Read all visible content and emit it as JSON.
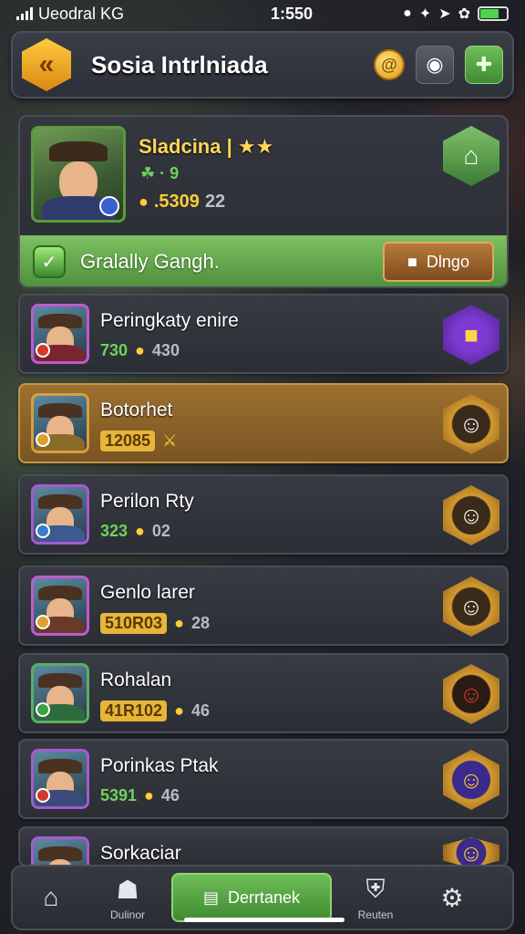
{
  "status_bar": {
    "carrier": "Ueodral KG",
    "time": "1:550"
  },
  "header": {
    "back_icon": "chevron-left-icon",
    "title": "Sosia Intrlniada",
    "coin_icon": "coin-icon",
    "map_icon": "map-pin-icon",
    "add_icon": "plus-icon"
  },
  "profile": {
    "name": "Sladcina |",
    "sub": "☘ · 9",
    "gold": ".5309",
    "extra": "22",
    "guild_label": "Gralally Gangh.",
    "guild_button": "Dlngo"
  },
  "rows": [
    {
      "name": "Peringkaty enire",
      "stat_a": "730",
      "stat_a_style": "green",
      "stat_b": "430",
      "badge": "purple"
    },
    {
      "name": "Botorhet",
      "stat_a": "12085",
      "stat_a_style": "pill",
      "stat_b": "",
      "badge": "gold"
    },
    {
      "name": "Perilon Rty",
      "stat_a": "323",
      "stat_a_style": "green",
      "stat_b": "02",
      "badge": "gold"
    },
    {
      "name": "Genlo larer",
      "stat_a": "510R03",
      "stat_a_style": "pill",
      "stat_b": "28",
      "badge": "gold"
    },
    {
      "name": "Rohalan",
      "stat_a": "41R102",
      "stat_a_style": "pill",
      "stat_b": "46",
      "badge": "gold-r"
    },
    {
      "name": "Porinkas Ptak",
      "stat_a": "5391",
      "stat_a_style": "green",
      "stat_b": "46",
      "badge": "navy"
    },
    {
      "name": "Sorkaciar",
      "stat_a": "",
      "stat_a_style": "",
      "stat_b": "",
      "badge": "navy"
    }
  ],
  "bottom_nav": {
    "home_label": "",
    "shop_label": "Dulinor",
    "main_label": "Derrtanek",
    "filter_label": "Reuten",
    "settings_label": ""
  },
  "colors": {
    "accent_green": "#4e8f3c",
    "gold": "#ffcd3a",
    "panel": "#2c2e35",
    "highlight_row": "#9c7030"
  }
}
